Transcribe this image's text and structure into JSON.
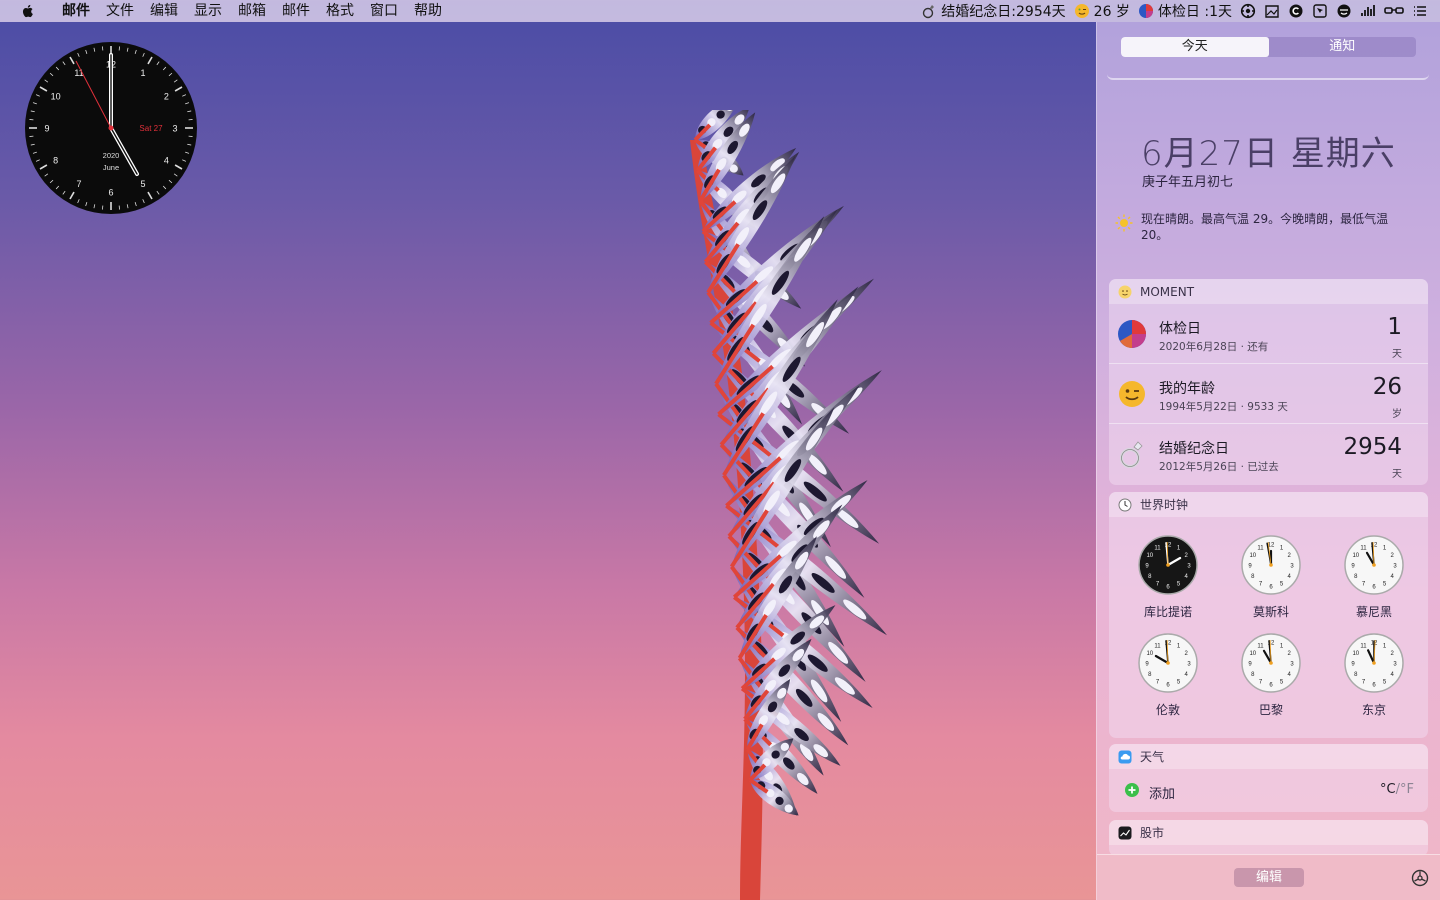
{
  "menubar": {
    "app_name": "邮件",
    "items": [
      "文件",
      "编辑",
      "显示",
      "邮箱",
      "邮件",
      "格式",
      "窗口",
      "帮助"
    ],
    "status": {
      "anniversary": "结婚纪念日:2954天",
      "age": "26 岁",
      "checkup": "体检日 :1天"
    }
  },
  "desktop_clock": {
    "date": "Sat 27",
    "year": "2020",
    "month": "June",
    "numerals": [
      "12",
      "1",
      "2",
      "3",
      "4",
      "5",
      "6",
      "7",
      "8",
      "9",
      "10",
      "11"
    ]
  },
  "notification_center": {
    "tabs": [
      "今天",
      "通知"
    ],
    "date": "6月27日 星期六",
    "lunar": "庚子年五月初七",
    "weather_summary": "现在晴朗。最高气温 29。今晚晴朗，最低气温 20。",
    "moment": {
      "header": "MOMENT",
      "rows": [
        {
          "title": "体检日",
          "sub": "2020年6月28日 · 还有",
          "num": "1",
          "unit": "天"
        },
        {
          "title": "我的年龄",
          "sub": "1994年5月22日 · 9533 天",
          "num": "26",
          "unit": "岁"
        },
        {
          "title": "结婚纪念日",
          "sub": "2012年5月26日 · 已过去",
          "num": "2954",
          "unit": "天"
        }
      ]
    },
    "world_clock": {
      "header": "世界时钟",
      "cities": [
        "库比提诺",
        "莫斯科",
        "慕尼黑",
        "伦敦",
        "巴黎",
        "东京"
      ]
    },
    "weather": {
      "header": "天气",
      "add_label": "添加",
      "unit_c": "°C",
      "sep": "/",
      "unit_f": "°F"
    },
    "stocks": {
      "header": "股市"
    },
    "edit_label": "编辑"
  },
  "colors": {
    "accent_red": "#e0303a",
    "stem": "#d9453a"
  },
  "icons": [
    "apple-icon",
    "ring-icon",
    "smile-icon",
    "pie-icon",
    "gear-icon",
    "sun-icon",
    "plus-icon"
  ]
}
